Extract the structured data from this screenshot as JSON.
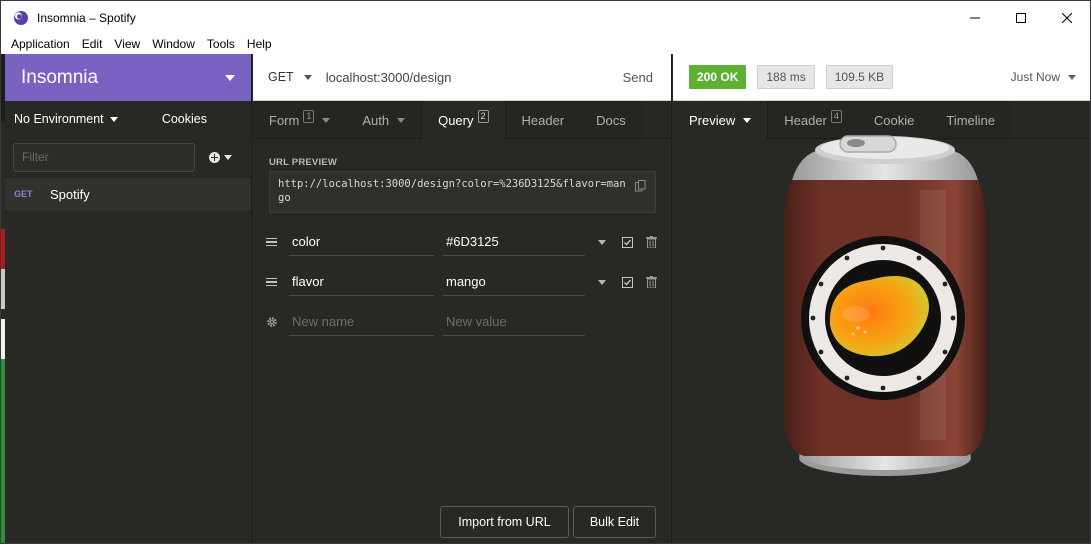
{
  "window": {
    "title": "Insomnia – Spotify"
  },
  "menu": [
    "Application",
    "Edit",
    "View",
    "Window",
    "Tools",
    "Help"
  ],
  "sidebar": {
    "workspace": "Insomnia",
    "environment": "No Environment",
    "cookies": "Cookies",
    "filter_placeholder": "Filter",
    "requests": [
      {
        "method": "GET",
        "name": "Spotify"
      }
    ]
  },
  "request": {
    "method": "GET",
    "url": "localhost:3000/design",
    "send_label": "Send",
    "tabs": [
      {
        "label": "Form",
        "badge": "1",
        "caret": true
      },
      {
        "label": "Auth",
        "badge": "",
        "caret": true
      },
      {
        "label": "Query",
        "badge": "2",
        "caret": false
      },
      {
        "label": "Header",
        "badge": "",
        "caret": false
      },
      {
        "label": "Docs",
        "badge": "",
        "caret": false
      }
    ],
    "active_tab": "Query",
    "url_preview_label": "URL PREVIEW",
    "url_preview": "http://localhost:3000/design?color=%236D3125&flavor=mango",
    "params": [
      {
        "name": "color",
        "value": "#6D3125"
      },
      {
        "name": "flavor",
        "value": "mango"
      }
    ],
    "new_name_placeholder": "New name",
    "new_value_placeholder": "New value",
    "import_button": "Import from URL",
    "bulk_edit_button": "Bulk Edit"
  },
  "response": {
    "status": "200 OK",
    "time": "188 ms",
    "size": "109.5 KB",
    "timestamp": "Just Now",
    "tabs": [
      {
        "label": "Preview",
        "badge": "",
        "caret": true
      },
      {
        "label": "Header",
        "badge": "4",
        "caret": false
      },
      {
        "label": "Cookie",
        "badge": "",
        "caret": false
      },
      {
        "label": "Timeline",
        "badge": "",
        "caret": false
      }
    ],
    "active_tab": "Preview",
    "preview": {
      "can_color": "#6D3125",
      "label_color": "#f08a00",
      "flavor": "mango"
    }
  },
  "colors": {
    "brand": "#7a62c2",
    "status_ok": "#5eb032",
    "background": "#282925"
  }
}
